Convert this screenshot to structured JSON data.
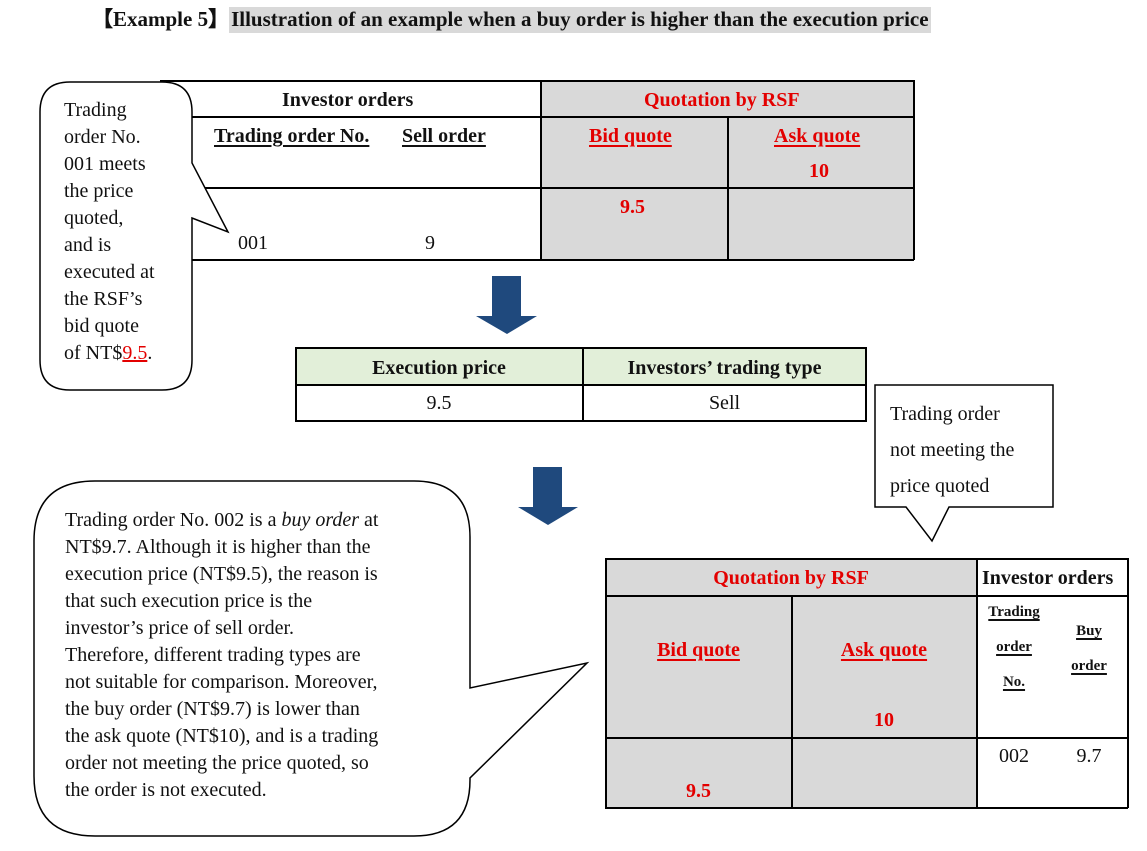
{
  "title": {
    "prefix": "【Example 5】",
    "text": "Illustration of an example when a buy order is higher than the execution price"
  },
  "table1": {
    "investor_header": "Investor orders",
    "quotation_header": "Quotation by RSF",
    "col_trading_no": "Trading order No.",
    "col_sell_order": "Sell order",
    "col_bid": "Bid quote",
    "col_ask": "Ask quote",
    "ask_value": "10",
    "bid_value": "9.5",
    "rows": [
      {
        "trading_no": "001",
        "sell_order": "9"
      }
    ]
  },
  "callout1": {
    "lines": [
      "Trading",
      "order No.",
      "001 meets",
      "the price",
      "quoted,",
      "and is",
      "executed at",
      "the RSF’s",
      "bid quote"
    ],
    "last_prefix": "of NT$",
    "last_value": "9.5",
    "last_suffix": "."
  },
  "execution_table": {
    "col_price": "Execution price",
    "col_type": "Investors’ trading type",
    "price": "9.5",
    "type": "Sell"
  },
  "callout2": {
    "lines": [
      "Trading order",
      "not meeting the",
      "price quoted"
    ]
  },
  "callout3": {
    "line1_pre": "Trading order No. 002 is a ",
    "line1_em": "buy order",
    "line1_post": " at",
    "lines": [
      "NT$9.7. Although it is higher than the",
      "execution price (NT$9.5), the reason is",
      "that such execution price is the",
      "investor’s price of sell order.",
      "Therefore, different trading types are",
      "not suitable for comparison. Moreover,",
      "the buy order (NT$9.7) is lower than",
      "the ask quote (NT$10), and is a trading",
      "order not meeting the price quoted, so",
      "the order is not executed."
    ]
  },
  "table2": {
    "quotation_header": "Quotation by RSF",
    "investor_header": "Investor orders",
    "col_bid": "Bid quote",
    "col_ask": "Ask quote",
    "col_trading_no_lines": [
      "Trading",
      "order",
      "No."
    ],
    "col_buy_order_lines": [
      "Buy",
      "order"
    ],
    "ask_value": "10",
    "bid_value": "9.5",
    "rows": [
      {
        "trading_no": "002",
        "buy_order": "9.7"
      }
    ]
  },
  "colors": {
    "accent_red": "#e30000",
    "quote_gray": "#d9d9d9",
    "header_green": "#e2efd9",
    "arrow_blue": "#1f497d"
  }
}
